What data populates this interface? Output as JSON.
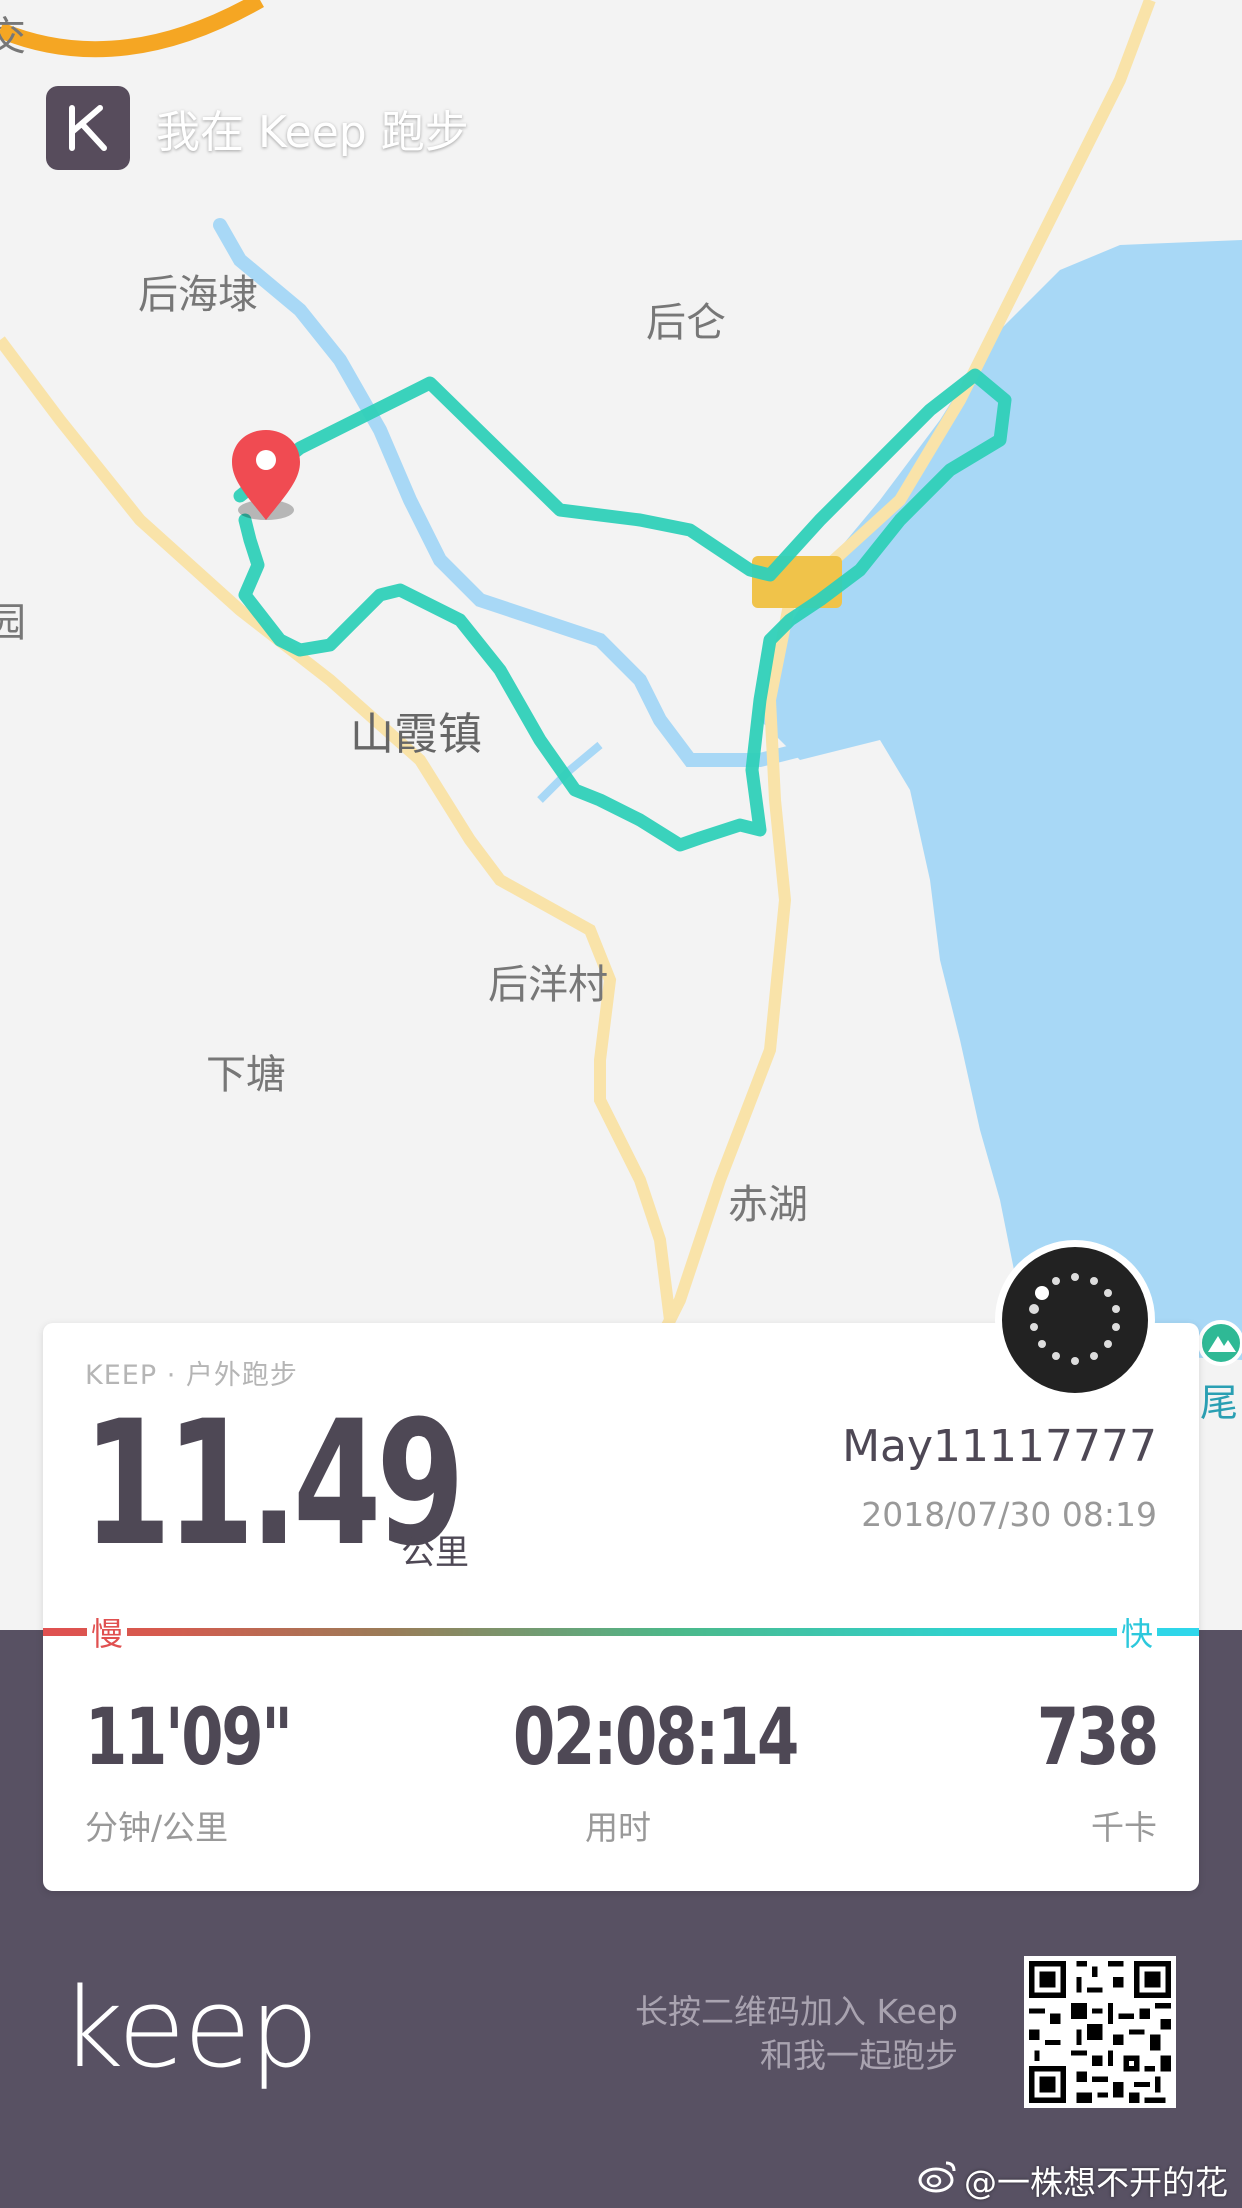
{
  "banner": {
    "text": "我在 Keep 跑步",
    "logo_icon": "keep-k-logo-icon"
  },
  "map": {
    "labels": {
      "houhaidai": "后海埭",
      "houcang": "后仑",
      "shanxia": "山霞镇",
      "houyang": "后洋村",
      "xiatang": "下塘",
      "chihu": "赤湖",
      "edge_left": "园",
      "edge_top": "交"
    },
    "route_color": "#2fd0b8",
    "water_color": "#a8d8f6",
    "road_color": "#f9e3a9"
  },
  "card": {
    "tag": "KEEP · 户外跑步",
    "distance": "11.49",
    "distance_unit": "公里",
    "username": "May11117777",
    "datetime": "2018/07/30 08:19",
    "slow_label": "慢",
    "fast_label": "快",
    "stats": [
      {
        "value": "11'09\"",
        "label": "分钟/公里"
      },
      {
        "value": "02:08:14",
        "label": "用时"
      },
      {
        "value": "738",
        "label": "千卡"
      }
    ]
  },
  "poi": {
    "label": "尾",
    "icon": "mountain-icon"
  },
  "footer": {
    "logo_text": "keep",
    "qr_line1": "长按二维码加入 Keep",
    "qr_line2": "和我一起跑步",
    "qr_icon": "qr-code-icon"
  },
  "watermark": {
    "icon": "weibo-icon",
    "text": "@一株想不开的花"
  }
}
